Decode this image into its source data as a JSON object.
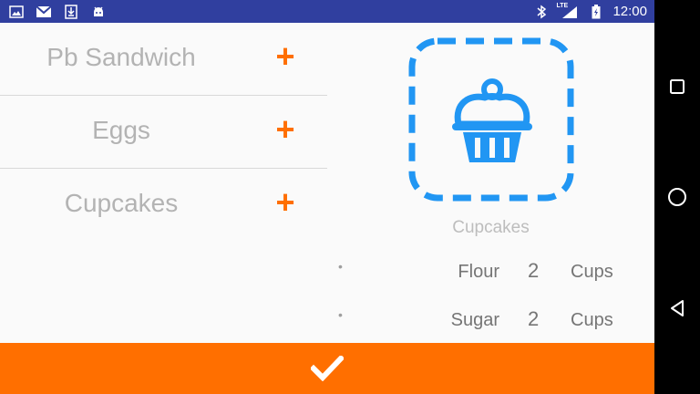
{
  "status_bar": {
    "time": "12:00",
    "network_label": "LTE",
    "left_icons": [
      "image-icon",
      "gmail-icon",
      "download-icon",
      "android-icon"
    ],
    "right_icons": [
      "bluetooth-icon",
      "signal-icon",
      "battery-icon"
    ],
    "background_color": "#303f9f"
  },
  "food_list": {
    "items": [
      {
        "label": "Pb Sandwich",
        "action": "+"
      },
      {
        "label": "Eggs",
        "action": "+"
      },
      {
        "label": "Cupcakes",
        "action": "+"
      }
    ]
  },
  "detail": {
    "image_icon": "cupcake-icon",
    "title": "Cupcakes",
    "ingredients": [
      {
        "name": "Flour",
        "qty": "2",
        "unit": "Cups"
      },
      {
        "name": "Sugar",
        "qty": "2",
        "unit": "Cups"
      }
    ]
  },
  "confirm": {
    "icon": "check-icon"
  },
  "nav": {
    "icons": [
      "square-icon",
      "circle-icon",
      "triangle-icon"
    ]
  },
  "colors": {
    "accent": "#ff6f00",
    "icon_blue": "#2196f3",
    "status_bar": "#303f9f"
  }
}
